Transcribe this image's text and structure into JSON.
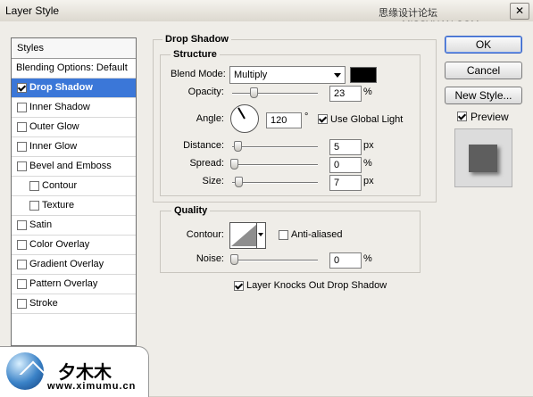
{
  "window": {
    "title": "Layer Style",
    "watermark_top": "思缘设计论坛  www.MISSYUAN.COM",
    "close_glyph": "✕"
  },
  "styles_panel": {
    "header": "Styles",
    "items": [
      {
        "label": "Blending Options: Default",
        "has_checkbox": false,
        "checked": false,
        "selected": false
      },
      {
        "label": "Drop Shadow",
        "has_checkbox": true,
        "checked": true,
        "selected": true
      },
      {
        "label": "Inner Shadow",
        "has_checkbox": true,
        "checked": false,
        "selected": false
      },
      {
        "label": "Outer Glow",
        "has_checkbox": true,
        "checked": false,
        "selected": false
      },
      {
        "label": "Inner Glow",
        "has_checkbox": true,
        "checked": false,
        "selected": false
      },
      {
        "label": "Bevel and Emboss",
        "has_checkbox": true,
        "checked": false,
        "selected": false
      },
      {
        "label": "Contour",
        "has_checkbox": true,
        "checked": false,
        "selected": false
      },
      {
        "label": "Texture",
        "has_checkbox": true,
        "checked": false,
        "selected": false
      },
      {
        "label": "Satin",
        "has_checkbox": true,
        "checked": false,
        "selected": false
      },
      {
        "label": "Color Overlay",
        "has_checkbox": true,
        "checked": false,
        "selected": false
      },
      {
        "label": "Gradient Overlay",
        "has_checkbox": true,
        "checked": false,
        "selected": false
      },
      {
        "label": "Pattern Overlay",
        "has_checkbox": true,
        "checked": false,
        "selected": false
      },
      {
        "label": "Stroke",
        "has_checkbox": true,
        "checked": false,
        "selected": false
      }
    ]
  },
  "drop_shadow": {
    "section_title": "Drop Shadow",
    "structure_title": "Structure",
    "blend_mode_label": "Blend Mode:",
    "blend_mode_value": "Multiply",
    "shadow_color": "#000000",
    "opacity_label": "Opacity:",
    "opacity_value": "23",
    "opacity_unit": "%",
    "angle_label": "Angle:",
    "angle_value": "120",
    "angle_unit": "°",
    "use_global_light_label": "Use Global Light",
    "use_global_light_checked": true,
    "distance_label": "Distance:",
    "distance_value": "5",
    "distance_unit": "px",
    "spread_label": "Spread:",
    "spread_value": "0",
    "spread_unit": "%",
    "size_label": "Size:",
    "size_value": "7",
    "size_unit": "px"
  },
  "quality": {
    "section_title": "Quality",
    "contour_label": "Contour:",
    "anti_aliased_label": "Anti-aliased",
    "anti_aliased_checked": false,
    "noise_label": "Noise:",
    "noise_value": "0",
    "noise_unit": "%"
  },
  "knockout": {
    "label": "Layer Knocks Out Drop Shadow",
    "checked": true
  },
  "buttons": {
    "ok": "OK",
    "cancel": "Cancel",
    "new_style": "New Style..."
  },
  "preview": {
    "label": "Preview",
    "checked": true
  },
  "logo": {
    "name": "夕木木",
    "url": "www.ximumu.cn"
  },
  "icons": [
    "close-icon",
    "dropdown-arrow-icon",
    "angle-dial-icon",
    "contour-icon",
    "checkbox-icon",
    "logo-icon"
  ]
}
